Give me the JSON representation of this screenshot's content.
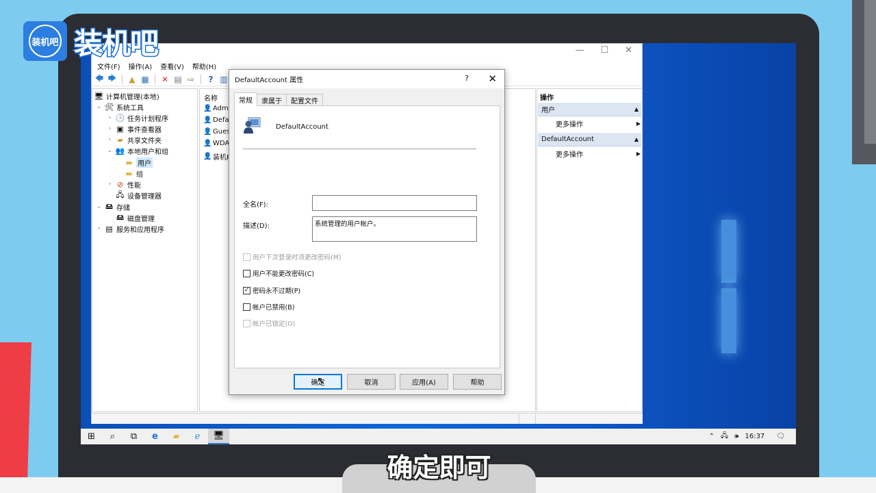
{
  "brand": {
    "badge": "装机吧",
    "name": "装机吧"
  },
  "caption": "确定即可",
  "mmc": {
    "menu": [
      "文件(F)",
      "操作(A)",
      "查看(V)",
      "帮助(H)"
    ],
    "tree": [
      {
        "label": "计算机管理(本地)",
        "icon": "computer-icon"
      },
      {
        "label": "系统工具",
        "icon": "tools-icon"
      },
      {
        "label": "任务计划程序",
        "icon": "clock-icon"
      },
      {
        "label": "事件查看器",
        "icon": "event-viewer-icon"
      },
      {
        "label": "共享文件夹",
        "icon": "shared-folder-icon"
      },
      {
        "label": "本地用户和组",
        "icon": "users-icon"
      },
      {
        "label": "用户",
        "icon": "folder-icon"
      },
      {
        "label": "组",
        "icon": "folder-icon"
      },
      {
        "label": "性能",
        "icon": "performance-icon"
      },
      {
        "label": "设备管理器",
        "icon": "device-manager-icon"
      },
      {
        "label": "存储",
        "icon": "storage-icon"
      },
      {
        "label": "磁盘管理",
        "icon": "disk-icon"
      },
      {
        "label": "服务和应用程序",
        "icon": "services-icon"
      }
    ],
    "list": {
      "header": "名称",
      "items": [
        "Admi",
        "Defa",
        "Gues",
        "WDA",
        "装机R"
      ]
    },
    "actions": {
      "title": "操作",
      "sections": [
        {
          "header": "用户",
          "item": "更多操作"
        },
        {
          "header": "DefaultAccount",
          "item": "更多操作"
        }
      ]
    }
  },
  "dialog": {
    "title": "DefaultAccount 属性",
    "help": "?",
    "close": "✕",
    "tabs": [
      "常规",
      "隶属于",
      "配置文件"
    ],
    "account_name": "DefaultAccount",
    "fullname_label": "全名(F):",
    "fullname_value": "",
    "description_label": "描述(D):",
    "description_value": "系统管理的用户帐户。",
    "checkboxes": [
      {
        "label": "用户下次登录时须更改密码(M)",
        "checked": false,
        "disabled": true
      },
      {
        "label": "用户不能更改密码(C)",
        "checked": false,
        "disabled": false
      },
      {
        "label": "密码永不过期(P)",
        "checked": true,
        "disabled": false
      },
      {
        "label": "帐户已禁用(B)",
        "checked": false,
        "disabled": false
      },
      {
        "label": "帐户已锁定(O)",
        "checked": false,
        "disabled": true
      }
    ],
    "buttons": {
      "ok": "确定",
      "cancel": "取消",
      "apply": "应用(A)",
      "help": "帮助"
    }
  },
  "taskbar": {
    "time": "16:37"
  },
  "colors": {
    "accent": "#0078d7",
    "desktop": "#1167d6",
    "brand": "#2c7ee0",
    "red": "#ef3d45"
  }
}
